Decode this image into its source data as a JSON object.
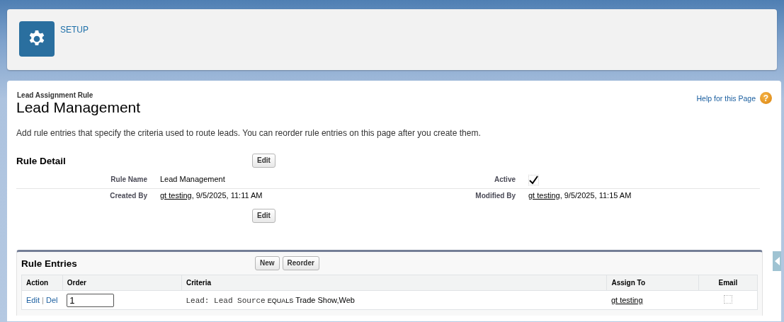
{
  "header": {
    "title": "SETUP"
  },
  "page": {
    "subtitle": "Lead Assignment Rule",
    "title": "Lead Management",
    "help_link": "Help for this Page",
    "help_icon": "?",
    "description": "Add rule entries that specify the criteria used to route leads. You can reorder rule entries on this page after you create them."
  },
  "rule_detail": {
    "title": "Rule Detail",
    "top_button": "Edit",
    "bottom_button": "Edit",
    "fields": [
      {
        "label": "Rule Name",
        "kind": "text",
        "value": "Lead Management"
      },
      {
        "label": "Active",
        "kind": "checkbox",
        "checked": true
      },
      {
        "label": "Created By",
        "kind": "user",
        "user": "gt testing",
        "rest": ", 9/5/2025, 11:11 AM"
      },
      {
        "label": "Modified By",
        "kind": "user",
        "user": "gt testing",
        "rest": ", 9/5/2025, 11:15 AM"
      }
    ]
  },
  "rule_entries": {
    "title": "Rule Entries",
    "buttons": [
      "New",
      "Reorder"
    ],
    "columns": [
      "Action",
      "Order",
      "Criteria",
      "Assign To",
      "Email"
    ],
    "rows": [
      {
        "actions": [
          "Edit",
          "Del"
        ],
        "action_separator": "|",
        "order": "1",
        "criteria_field": "Lead: Lead Source",
        "criteria_operator": "EQUALS",
        "criteria_value": "Trade Show,Web",
        "assign_to": "gt testing",
        "email": false
      }
    ]
  }
}
